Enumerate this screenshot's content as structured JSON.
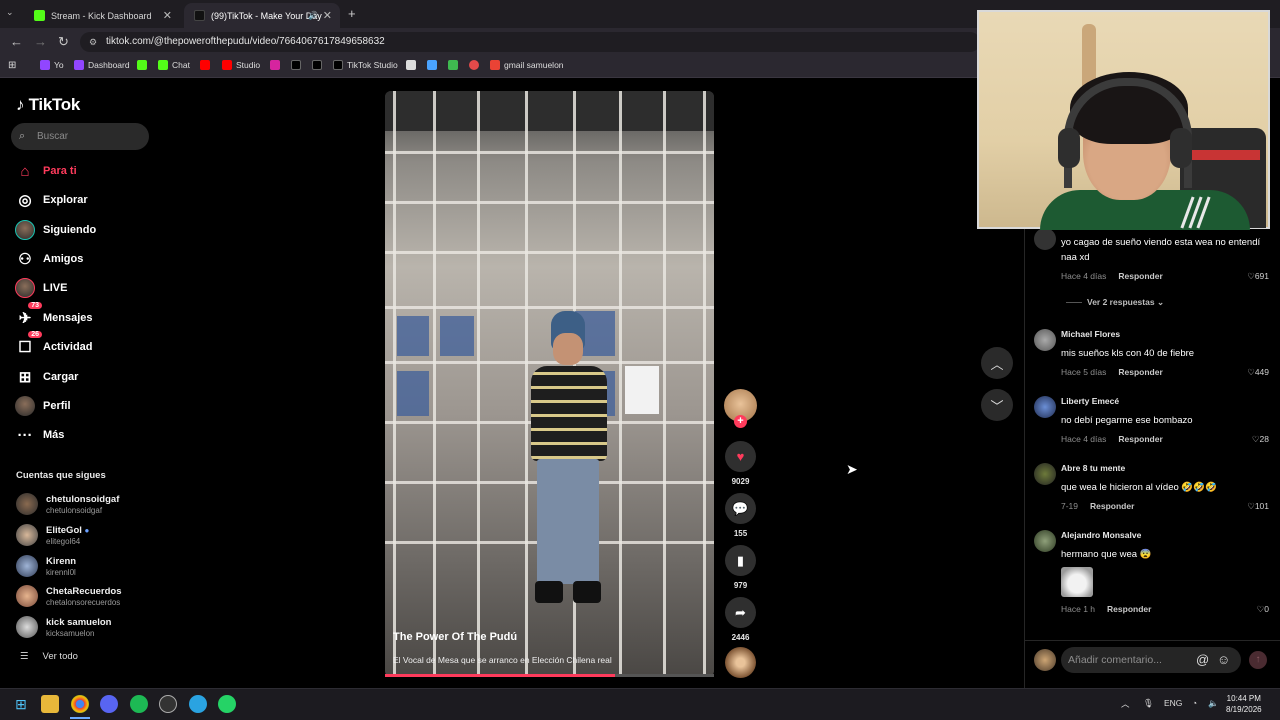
{
  "browser": {
    "tabs": [
      {
        "label": "Stream - Kick Dashboard"
      },
      {
        "label": "(99)TikTok - Make Your Day"
      }
    ],
    "url": "tiktok.com/@thepowerofthepudu/video/7664067617849658632",
    "bookmarks": [
      "Yo",
      "Dashboard",
      "Chat",
      "Studio",
      "TikTok Studio",
      "gmail samuelon"
    ]
  },
  "sidebar": {
    "logo": "TikTok",
    "search_placeholder": "Buscar",
    "nav": [
      {
        "label": "Para ti",
        "icon": "home-icon",
        "active": true
      },
      {
        "label": "Explorar",
        "icon": "compass-icon"
      },
      {
        "label": "Siguiendo",
        "icon": "following-avatar"
      },
      {
        "label": "Amigos",
        "icon": "friends-icon"
      },
      {
        "label": "LIVE",
        "icon": "live-avatar"
      },
      {
        "label": "Mensajes",
        "icon": "inbox-icon",
        "badge": "73"
      },
      {
        "label": "Actividad",
        "icon": "activity-icon",
        "badge": "26"
      },
      {
        "label": "Cargar",
        "icon": "upload-icon"
      },
      {
        "label": "Perfil",
        "icon": "profile-avatar"
      },
      {
        "label": "Más",
        "icon": "more-icon"
      }
    ],
    "following_title": "Cuentas que sigues",
    "following": [
      {
        "name": "chetulonsoidgaf",
        "handle": "chetulonsoidgaf"
      },
      {
        "name": "EliteGol",
        "handle": "elitegol64",
        "verified": true
      },
      {
        "name": "Kirenn",
        "handle": "kirennl0l"
      },
      {
        "name": "ChetaRecuerdos",
        "handle": "chetalonsorecuerdos"
      },
      {
        "name": "kick samuelon",
        "handle": "kicksamuelon"
      }
    ],
    "see_all": "Ver todo"
  },
  "video": {
    "author": "The Power Of The Pudú",
    "description": "El Vocal de Mesa que se arranco en Elección Chilena real",
    "progress": 0.7,
    "likes": "9029",
    "comments": "155",
    "saves": "979",
    "shares": "2446"
  },
  "comments": [
    {
      "user": "",
      "text": "yo cagao de sueño viendo esta wea no entendí naa xd",
      "time": "Hace 4 días",
      "reply": "Responder",
      "likes": "691",
      "replies_label": "Ver 2 respuestas"
    },
    {
      "user": "Michael Flores",
      "text": "mis sueños kls con 40 de fiebre",
      "time": "Hace 5 días",
      "reply": "Responder",
      "likes": "449"
    },
    {
      "user": "Liberty Emecé",
      "text": "no debí pegarme ese bombazo",
      "time": "Hace 4 días",
      "reply": "Responder",
      "likes": "28"
    },
    {
      "user": "Abre 8 tu mente",
      "text": "que wea le hicieron al vídeo 🤣🤣🤣",
      "time": "7-19",
      "reply": "Responder",
      "likes": "101"
    },
    {
      "user": "Alejandro Monsalve",
      "text": "hermano que wea 😨",
      "time": "Hace 1 h",
      "reply": "Responder",
      "likes": "0"
    }
  ],
  "composer": {
    "placeholder": "Añadir comentario..."
  },
  "system": {
    "lang": "ENG",
    "time": "10:44 PM",
    "date": "8/19/2026"
  },
  "colors": {
    "accent": "#ff3b5c",
    "background": "#000000"
  }
}
